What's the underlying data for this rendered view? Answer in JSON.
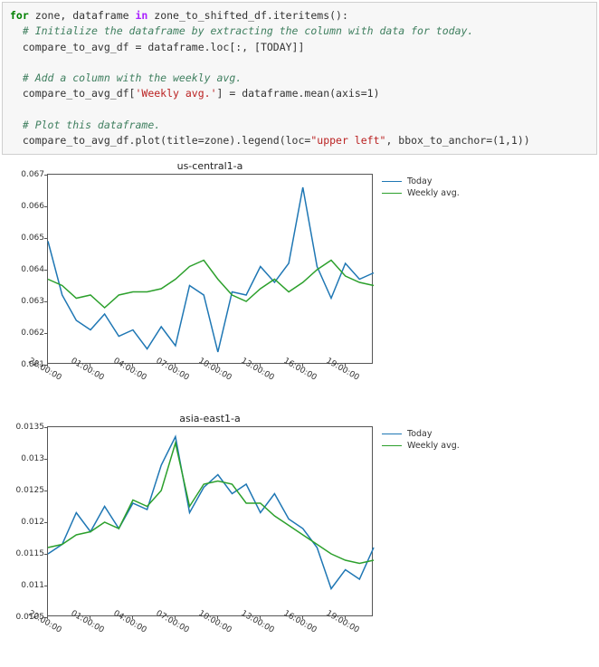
{
  "code": {
    "l1a": "for",
    "l1b": " zone, dataframe ",
    "l1c": "in",
    "l1d": " zone_to_shifted_df.iteritems():",
    "l2": "  # Initialize the dataframe by extracting the column with data for today.",
    "l3": "  compare_to_avg_df = dataframe.loc[:, [TODAY]]",
    "l5": "  # Add a column with the weekly avg.",
    "l6a": "  compare_to_avg_df[",
    "l6b": "'Weekly avg.'",
    "l6c": "] = dataframe.mean(axis=1)",
    "l8": "  # Plot this dataframe.",
    "l9a": "  compare_to_avg_df.plot(title=zone).legend(loc=",
    "l9b": "\"upper left\"",
    "l9c": ", bbox_to_anchor=(1,1))"
  },
  "colors": {
    "today": "#1f77b4",
    "weekly": "#2ca02c"
  },
  "legend": {
    "today": "Today",
    "weekly": "Weekly avg."
  },
  "chart_data": [
    {
      "type": "line",
      "title": "us-central1-a",
      "xlabel": "",
      "ylabel": "",
      "ylim": [
        0.061,
        0.067
      ],
      "y_ticks": [
        0.061,
        0.062,
        0.063,
        0.064,
        0.065,
        0.066,
        0.067
      ],
      "x": [
        "22:00:00",
        "23:00:00",
        "00:00:00",
        "01:00:00",
        "02:00:00",
        "03:00:00",
        "04:00:00",
        "05:00:00",
        "06:00:00",
        "07:00:00",
        "08:00:00",
        "09:00:00",
        "10:00:00",
        "11:00:00",
        "12:00:00",
        "13:00:00",
        "14:00:00",
        "15:00:00",
        "16:00:00",
        "17:00:00",
        "18:00:00",
        "19:00:00",
        "20:00:00",
        "21:00:00"
      ],
      "x_ticks": [
        "22:00:00",
        "01:00:00",
        "04:00:00",
        "07:00:00",
        "10:00:00",
        "13:00:00",
        "16:00:00",
        "19:00:00"
      ],
      "series": [
        {
          "name": "Today",
          "color": "#1f77b4",
          "values": [
            0.0649,
            0.0632,
            0.0624,
            0.0621,
            0.0626,
            0.0619,
            0.0621,
            0.0615,
            0.0622,
            0.0616,
            0.0635,
            0.0632,
            0.0614,
            0.0633,
            0.0632,
            0.0641,
            0.0636,
            0.0642,
            0.0666,
            0.0641,
            0.0631,
            0.0642,
            0.0637,
            0.0639
          ]
        },
        {
          "name": "Weekly avg.",
          "color": "#2ca02c",
          "values": [
            0.0637,
            0.0635,
            0.0631,
            0.0632,
            0.0628,
            0.0632,
            0.0633,
            0.0633,
            0.0634,
            0.0637,
            0.0641,
            0.0643,
            0.0637,
            0.0632,
            0.063,
            0.0634,
            0.0637,
            0.0633,
            0.0636,
            0.064,
            0.0643,
            0.0638,
            0.0636,
            0.0635
          ]
        }
      ]
    },
    {
      "type": "line",
      "title": "asia-east1-a",
      "xlabel": "",
      "ylabel": "",
      "ylim": [
        0.0105,
        0.0135
      ],
      "y_ticks": [
        0.0105,
        0.011,
        0.0115,
        0.012,
        0.0125,
        0.013,
        0.0135
      ],
      "x": [
        "22:00:00",
        "23:00:00",
        "00:00:00",
        "01:00:00",
        "02:00:00",
        "03:00:00",
        "04:00:00",
        "05:00:00",
        "06:00:00",
        "07:00:00",
        "08:00:00",
        "09:00:00",
        "10:00:00",
        "11:00:00",
        "12:00:00",
        "13:00:00",
        "14:00:00",
        "15:00:00",
        "16:00:00",
        "17:00:00",
        "18:00:00",
        "19:00:00",
        "20:00:00",
        "21:00:00"
      ],
      "x_ticks": [
        "22:00:00",
        "01:00:00",
        "04:00:00",
        "07:00:00",
        "10:00:00",
        "13:00:00",
        "16:00:00",
        "19:00:00"
      ],
      "series": [
        {
          "name": "Today",
          "color": "#1f77b4",
          "values": [
            0.0115,
            0.01165,
            0.01215,
            0.01185,
            0.01225,
            0.0119,
            0.0123,
            0.0122,
            0.0129,
            0.01335,
            0.01215,
            0.01255,
            0.01275,
            0.01245,
            0.0126,
            0.01215,
            0.01245,
            0.01205,
            0.0119,
            0.0116,
            0.01095,
            0.01125,
            0.0111,
            0.0116
          ]
        },
        {
          "name": "Weekly avg.",
          "color": "#2ca02c",
          "values": [
            0.0116,
            0.01165,
            0.0118,
            0.01185,
            0.012,
            0.0119,
            0.01235,
            0.01225,
            0.0125,
            0.01325,
            0.01225,
            0.0126,
            0.01265,
            0.0126,
            0.0123,
            0.0123,
            0.0121,
            0.01195,
            0.0118,
            0.01165,
            0.0115,
            0.0114,
            0.01135,
            0.0114
          ]
        }
      ]
    }
  ]
}
